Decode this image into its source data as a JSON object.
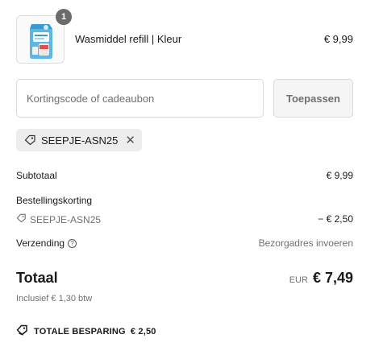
{
  "line_item": {
    "quantity": "1",
    "name": "Wasmiddel refill | Kleur",
    "price": "€ 9,99",
    "image_icon": "detergent-refill-pouch-icon"
  },
  "discount": {
    "placeholder": "Kortingscode of cadeaubon",
    "value": "",
    "apply_label": "Toepassen",
    "applied_code": "SEEPJE-ASN25",
    "remove_symbol": "✕"
  },
  "summary": {
    "subtotal_label": "Subtotaal",
    "subtotal_value": "€ 9,99",
    "order_discount_label": "Bestellingskorting",
    "order_discount_code": "SEEPJE-ASN25",
    "order_discount_value": "− € 2,50",
    "shipping_label": "Verzending",
    "shipping_value": "Bezorgadres invoeren"
  },
  "total": {
    "label": "Totaal",
    "currency": "EUR",
    "amount": "€ 7,49",
    "tax_note": "Inclusief € 1,30 btw"
  },
  "savings": {
    "label": "TOTALE BESPARING",
    "amount": "€ 2,50"
  },
  "colors": {
    "chip_bg": "#ededed",
    "muted_text": "#707070",
    "badge_bg": "#6b6b6b"
  }
}
